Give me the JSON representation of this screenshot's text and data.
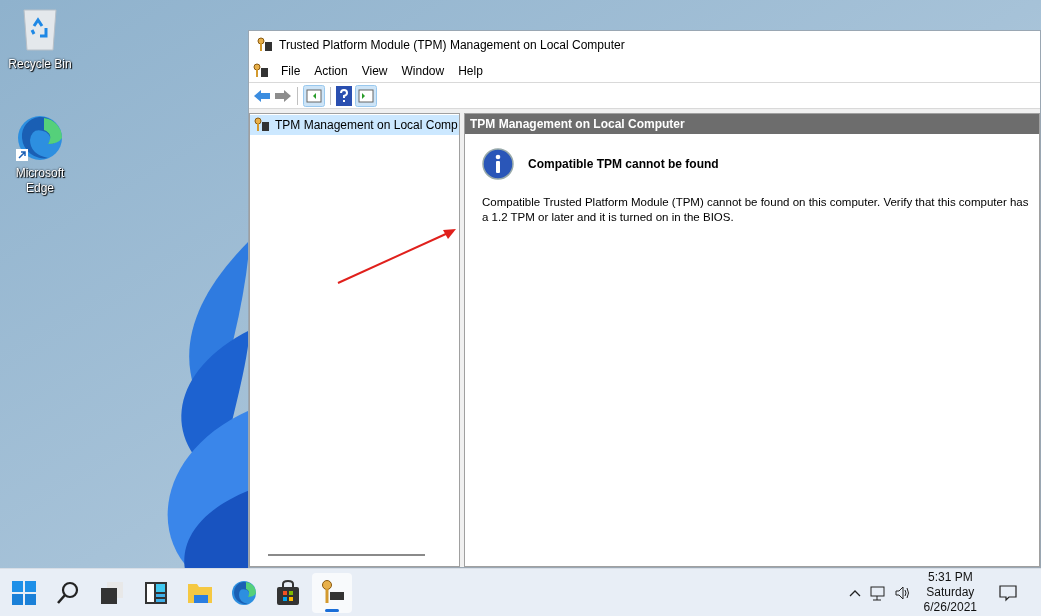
{
  "desktop_icons": [
    {
      "kind": "recycle",
      "label": "Recycle Bin"
    },
    {
      "kind": "edge",
      "label": "Microsoft Edge"
    }
  ],
  "window": {
    "title": "Trusted Platform Module (TPM) Management on Local Computer",
    "menu": [
      "File",
      "Action",
      "View",
      "Window",
      "Help"
    ],
    "tree": [
      {
        "label": "TPM Management on Local Comp",
        "selected": true
      }
    ],
    "content_header": "TPM Management on Local Computer",
    "message_title": "Compatible TPM cannot be found",
    "message_body": "Compatible Trusted Platform Module (TPM) cannot be found on this computer. Verify that this computer has a 1.2 TPM or later and it is turned on in the BIOS."
  },
  "taskbar": {
    "apps": [
      {
        "kind": "start",
        "selected": false
      },
      {
        "kind": "search",
        "selected": false
      },
      {
        "kind": "taskview",
        "selected": false
      },
      {
        "kind": "widgets",
        "selected": false
      },
      {
        "kind": "explorer",
        "selected": false
      },
      {
        "kind": "edge",
        "selected": false
      },
      {
        "kind": "store",
        "selected": false
      },
      {
        "kind": "tpm",
        "selected": true
      }
    ],
    "time": "5:31 PM",
    "day": "Saturday",
    "date": "6/26/2021"
  }
}
